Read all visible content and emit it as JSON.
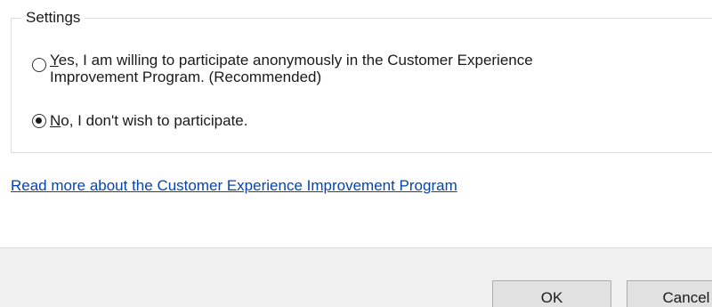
{
  "settings": {
    "legend": "Settings",
    "options": [
      {
        "line1_mnemonic": "Y",
        "line1_rest": "es, I am willing to participate anonymously in the Customer Experience",
        "line2": "Improvement Program.  (Recommended)",
        "selected": false
      },
      {
        "mnemonic": "N",
        "rest": "o, I don't wish to participate.",
        "selected": true
      }
    ]
  },
  "link": {
    "text": "Read more about the Customer Experience Improvement Program",
    "color": "#0645ad"
  },
  "buttons": {
    "ok": "OK",
    "cancel": "Cancel"
  }
}
